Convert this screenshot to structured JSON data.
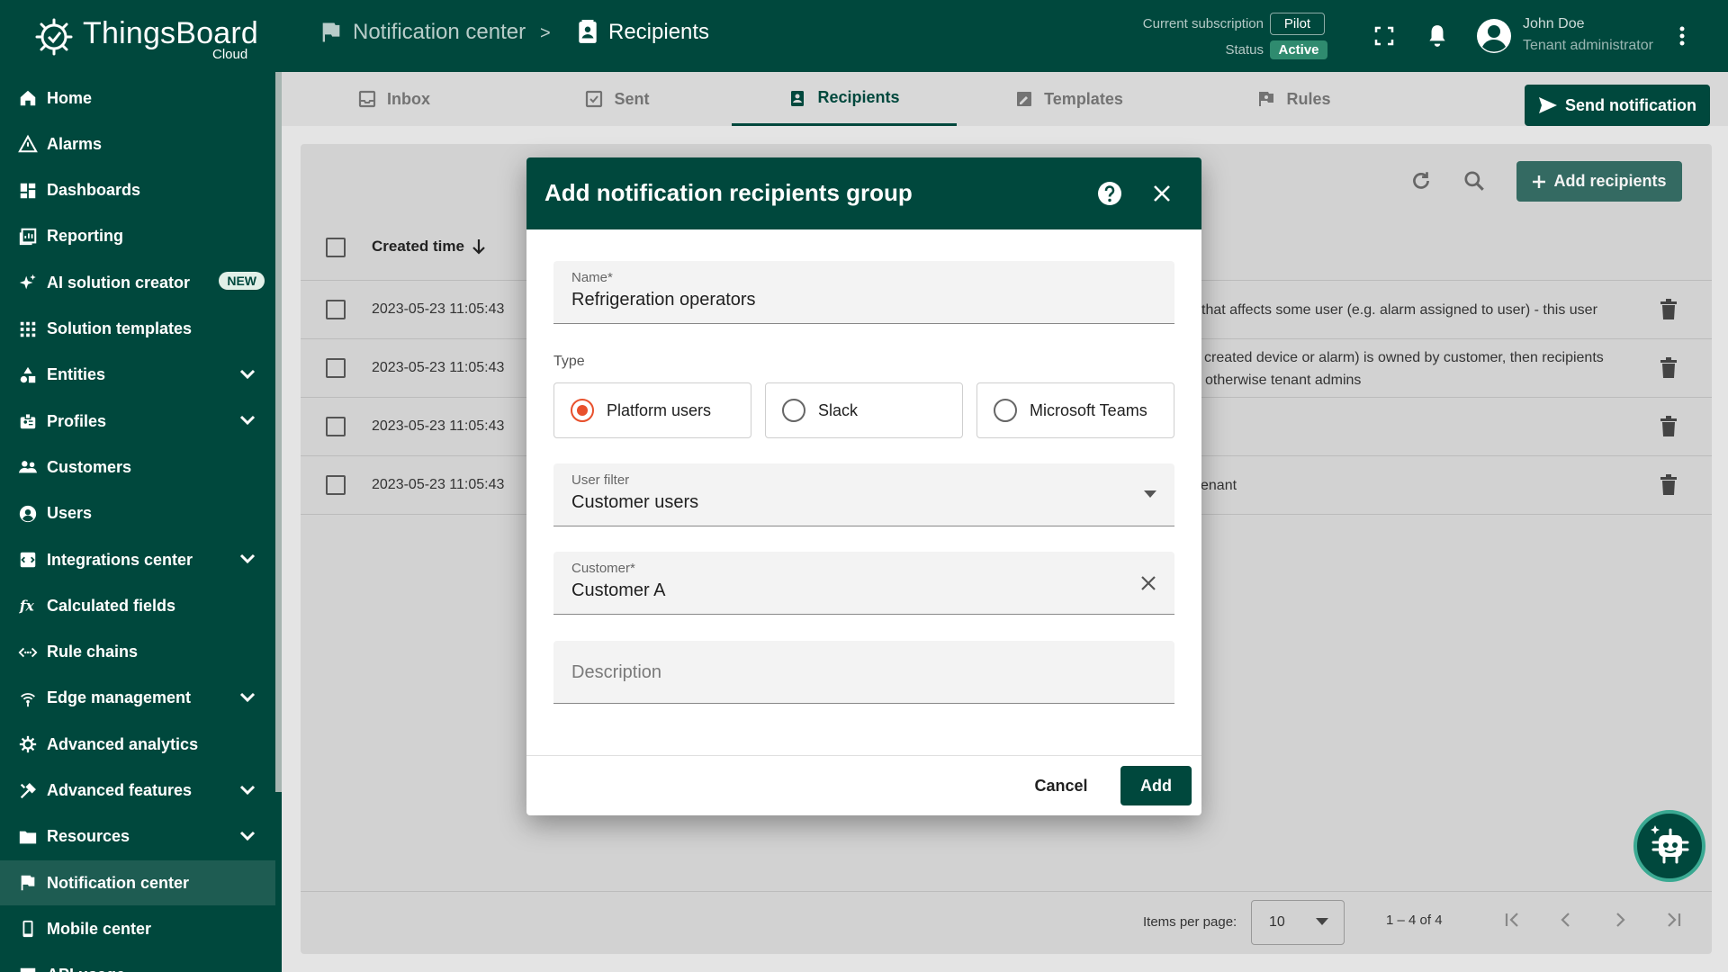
{
  "brand": {
    "name": "ThingsBoard",
    "sub": "Cloud"
  },
  "breadcrumb": {
    "parent": "Notification center",
    "separator": ">",
    "current": "Recipients"
  },
  "subscription": {
    "label": "Current subscription",
    "plan": "Pilot",
    "status_label": "Status",
    "status": "Active"
  },
  "user": {
    "name": "John Doe",
    "role": "Tenant administrator"
  },
  "sidebar": {
    "items": [
      {
        "label": "Home",
        "icon": "home-icon"
      },
      {
        "label": "Alarms",
        "icon": "warning-icon"
      },
      {
        "label": "Dashboards",
        "icon": "dashboard-icon"
      },
      {
        "label": "Reporting",
        "icon": "report-icon"
      },
      {
        "label": "AI solution creator",
        "icon": "sparkle-icon",
        "badge": "NEW"
      },
      {
        "label": "Solution templates",
        "icon": "apps-icon"
      },
      {
        "label": "Entities",
        "icon": "shapes-icon",
        "expandable": true
      },
      {
        "label": "Profiles",
        "icon": "badge-icon",
        "expandable": true
      },
      {
        "label": "Customers",
        "icon": "people-icon"
      },
      {
        "label": "Users",
        "icon": "account-icon"
      },
      {
        "label": "Integrations center",
        "icon": "integration-icon",
        "expandable": true
      },
      {
        "label": "Calculated fields",
        "icon": "function-icon"
      },
      {
        "label": "Rule chains",
        "icon": "rule-chain-icon"
      },
      {
        "label": "Edge management",
        "icon": "edge-icon",
        "expandable": true
      },
      {
        "label": "Advanced analytics",
        "icon": "analytics-icon"
      },
      {
        "label": "Advanced features",
        "icon": "tools-icon",
        "expandable": true
      },
      {
        "label": "Resources",
        "icon": "folder-icon",
        "expandable": true
      },
      {
        "label": "Notification center",
        "icon": "notification-icon",
        "active": true
      },
      {
        "label": "Mobile center",
        "icon": "mobile-icon"
      },
      {
        "label": "API usage",
        "icon": "chart-icon"
      }
    ]
  },
  "tabs": [
    {
      "label": "Inbox",
      "icon": "inbox-icon"
    },
    {
      "label": "Sent",
      "icon": "sent-icon"
    },
    {
      "label": "Recipients",
      "icon": "recipients-icon",
      "active": true
    },
    {
      "label": "Templates",
      "icon": "templates-icon"
    },
    {
      "label": "Rules",
      "icon": "rules-icon"
    }
  ],
  "send_notification_label": "Send notification",
  "table": {
    "add_label": "Add recipients",
    "columns": {
      "created": "Created time"
    },
    "rows": [
      {
        "created": "2023-05-23 11:05:43",
        "desc_lines": [
          "that affects some user (e.g. alarm assigned to user) - this user"
        ]
      },
      {
        "created": "2023-05-23 11:05:43",
        "desc_lines": [
          "created device or alarm) is owned by customer, then recipients",
          "otherwise tenant admins"
        ]
      },
      {
        "created": "2023-05-23 11:05:43",
        "desc_lines": [
          ""
        ]
      },
      {
        "created": "2023-05-23 11:05:43",
        "desc_lines": [
          "enant"
        ]
      }
    ]
  },
  "pagination": {
    "items_label": "Items per page:",
    "page_size": "10",
    "range": "1 – 4 of 4"
  },
  "dialog": {
    "title": "Add notification recipients group",
    "name_label": "Name*",
    "name_value": "Refrigeration operators",
    "type_label": "Type",
    "types": [
      "Platform users",
      "Slack",
      "Microsoft Teams"
    ],
    "selected_type": 0,
    "user_filter_label": "User filter",
    "user_filter_value": "Customer users",
    "customer_label": "Customer*",
    "customer_value": "Customer A",
    "description_placeholder": "Description",
    "cancel_label": "Cancel",
    "add_label": "Add"
  },
  "colors": {
    "brand": "#00483d",
    "radio_accent": "#e8502c"
  }
}
